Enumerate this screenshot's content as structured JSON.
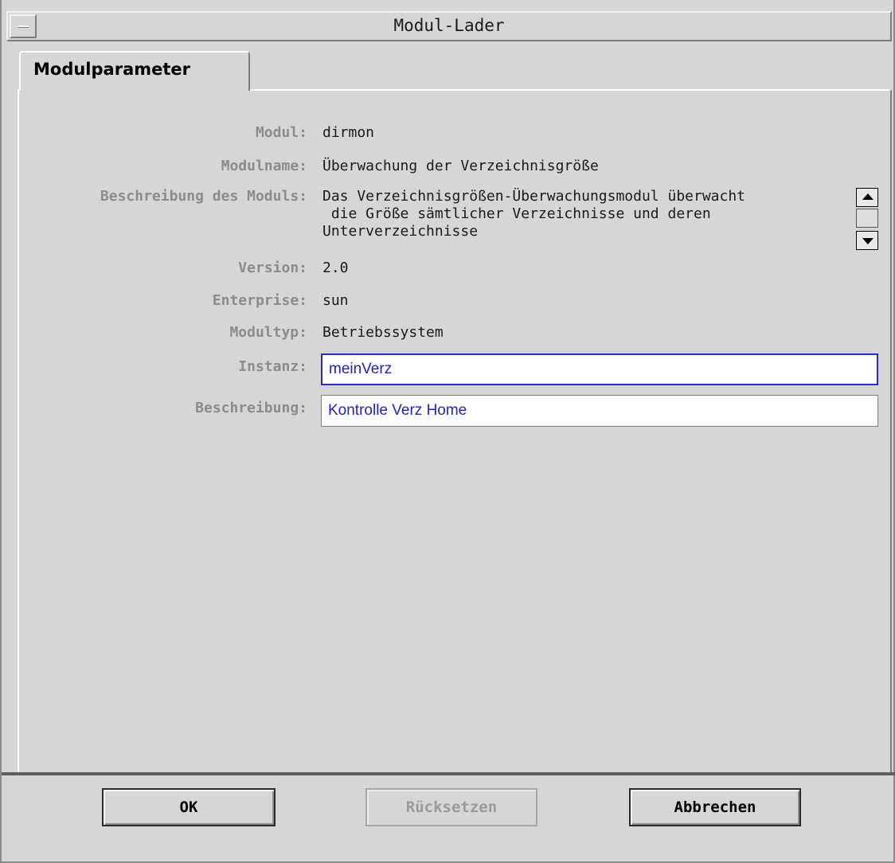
{
  "window": {
    "title": "Modul-Lader"
  },
  "tabs": [
    {
      "label": "Modulparameter",
      "active": true
    }
  ],
  "form": {
    "modul": {
      "label": "Modul:",
      "value": "dirmon"
    },
    "modulname": {
      "label": "Modulname:",
      "value": "Überwachung der Verzeichnisgröße"
    },
    "beschreibung_des_moduls": {
      "label": "Beschreibung des Moduls:",
      "value": "Das Verzeichnisgrößen-Überwachungsmodul überwacht\n die Größe sämtlicher Verzeichnisse und deren\nUnterverzeichnisse"
    },
    "version": {
      "label": "Version:",
      "value": "2.0"
    },
    "enterprise": {
      "label": "Enterprise:",
      "value": "sun"
    },
    "modultyp": {
      "label": "Modultyp:",
      "value": "Betriebssystem"
    },
    "instanz": {
      "label": "Instanz:",
      "value": "meinVerz"
    },
    "beschreibung": {
      "label": "Beschreibung:",
      "value": "Kontrolle Verz Home"
    }
  },
  "buttons": {
    "ok": "OK",
    "reset": "Rücksetzen",
    "cancel": "Abbrechen"
  },
  "colors": {
    "background": "#d6d6d6",
    "label_gray": "#8c8c8c",
    "input_text": "#2020c8",
    "focus_border": "#2b2bc4"
  },
  "icons": {
    "window_menu": "window-menu-icon",
    "scroll_up": "arrow-up-icon",
    "scroll_down": "arrow-down-icon"
  }
}
